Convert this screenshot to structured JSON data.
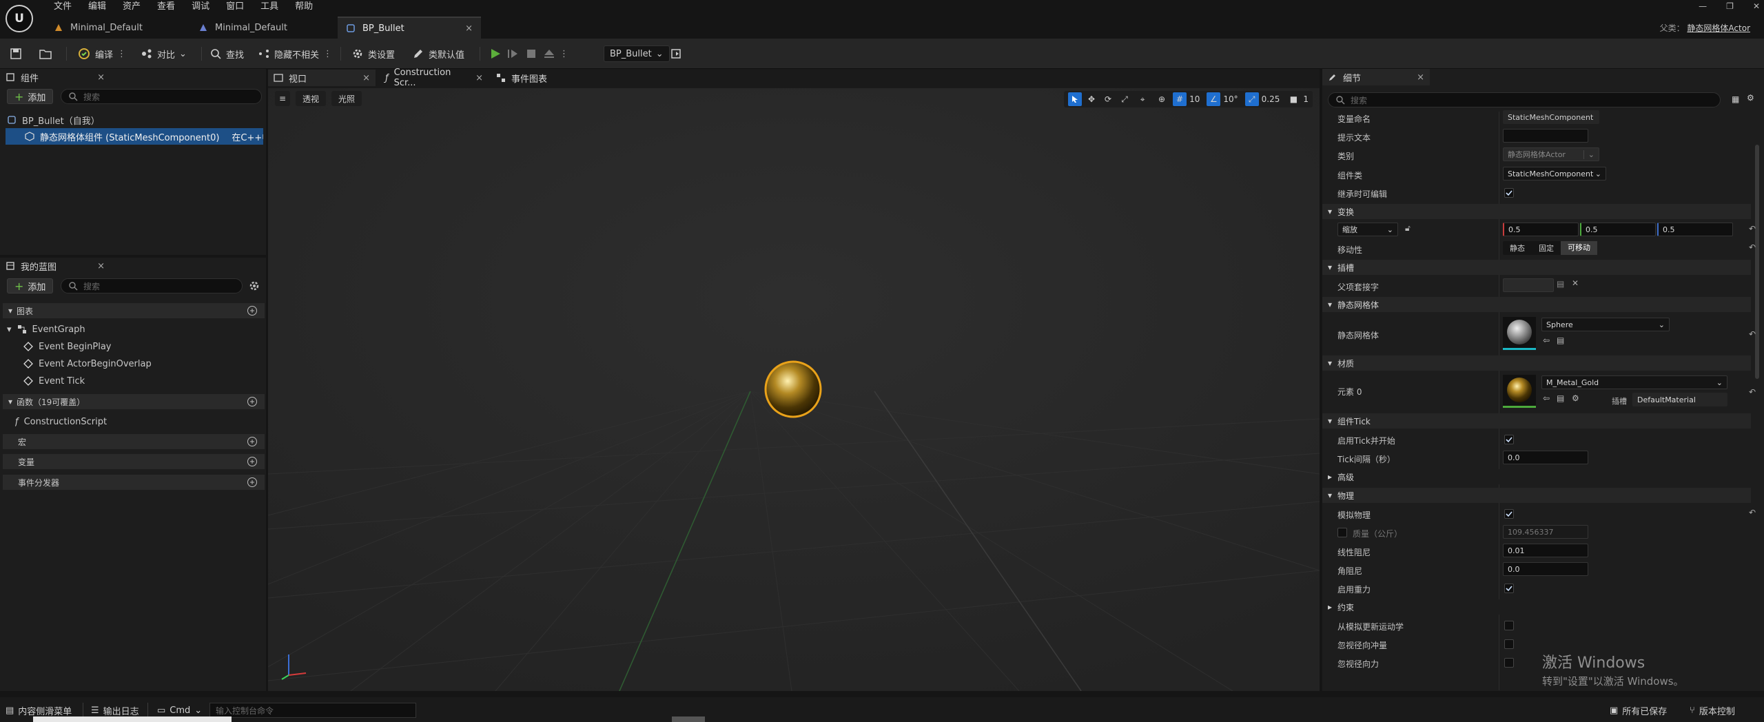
{
  "menu": [
    "文件",
    "编辑",
    "资产",
    "查看",
    "调试",
    "窗口",
    "工具",
    "帮助"
  ],
  "tabs": [
    {
      "label": "Minimal_Default"
    },
    {
      "label": "Minimal_Default"
    },
    {
      "label": "BP_Bullet",
      "close": "×"
    }
  ],
  "parent": {
    "label": "父类：",
    "value": "静态网格体Actor"
  },
  "toolbar": {
    "compile": "编译",
    "diff": "对比",
    "find": "查找",
    "hide_unrelated": "隐藏不相关",
    "class_settings": "类设置",
    "class_defaults": "类默认值",
    "debug_object": "BP_Bullet"
  },
  "components_panel": {
    "title": "组件",
    "add": "添加",
    "search_placeholder": "搜索",
    "items": [
      {
        "label": "BP_Bullet（自我）"
      },
      {
        "label": "静态网格体组件 (StaticMeshComponent0)",
        "suffix": "在C++中编辑"
      }
    ]
  },
  "blueprint_panel": {
    "title": "我的蓝图",
    "add": "添加",
    "search_placeholder": "搜索",
    "graphs_label": "图表",
    "event_graph": "EventGraph",
    "events": [
      "Event BeginPlay",
      "Event ActorBeginOverlap",
      "Event Tick"
    ],
    "functions_label": "函数（19可覆盖）",
    "construction_script": "ConstructionScript",
    "macros_label": "宏",
    "variables_label": "变量",
    "dispatchers_label": "事件分发器"
  },
  "center_tabs": [
    {
      "label": "视口",
      "close": "×"
    },
    {
      "label": "Construction Scr...",
      "close": "×"
    },
    {
      "label": "事件图表"
    }
  ],
  "viewport": {
    "perspective": "透视",
    "lit": "光照",
    "grid_snap": "10",
    "rotation_snap": "10°",
    "scale_snap": "0.25",
    "camera_speed": "1"
  },
  "details": {
    "title": "细节",
    "search_placeholder": "搜索",
    "variable_name_label": "变量命名",
    "variable_name": "StaticMeshComponent",
    "tooltip_label": "提示文本",
    "tooltip": "",
    "category_label": "类别",
    "category": "静态网格体Actor",
    "component_class_label": "组件类",
    "component_class": "StaticMeshComponent",
    "editable_when_inherited_label": "继承时可编辑",
    "transform_cat": "变换",
    "scale_mode": "缩放",
    "scale": [
      "0.5",
      "0.5",
      "0.5"
    ],
    "mobility_label": "移动性",
    "mobility": [
      "静态",
      "固定",
      "可移动"
    ],
    "sockets_cat": "插槽",
    "parent_socket_label": "父项套接字",
    "static_mesh_cat": "静态网格体",
    "static_mesh_label": "静态网格体",
    "static_mesh": "Sphere",
    "materials_cat": "材质",
    "element0_label": "元素 0",
    "material": "M_Metal_Gold",
    "slot_label": "插槽",
    "slot_value": "DefaultMaterial",
    "tick_cat": "组件Tick",
    "start_tick_label": "启用Tick并开始",
    "tick_interval_label": "Tick间隔（秒）",
    "tick_interval": "0.0",
    "advanced_cat": "高级",
    "physics_cat": "物理",
    "simulate_label": "模拟物理",
    "mass_label": "质量（公斤）",
    "mass": "109.456337",
    "linear_damping_label": "线性阻尼",
    "linear_damping": "0.01",
    "angular_damping_label": "角阻尼",
    "angular_damping": "0.0",
    "gravity_label": "启用重力",
    "constraints_cat": "约束",
    "update_kinematic_label": "从模拟更新运动学",
    "ignore_radial_impulse_label": "忽视径向冲量",
    "ignore_radial_force_label": "忽视径向力"
  },
  "bottom": {
    "content_drawer": "内容侧滑菜单",
    "output_log": "输出日志",
    "cmd": "Cmd",
    "console_placeholder": "输入控制台命令",
    "all_saved": "所有已保存",
    "source_control": "版本控制"
  },
  "watermark": {
    "line1": "激活 Windows",
    "line2": "转到\"设置\"以激活 Windows。"
  },
  "colors": {
    "accent": "#1f6fd0",
    "play_green": "#5cae3b",
    "selection": "#1d4f86",
    "gold": "#d4a52a"
  }
}
